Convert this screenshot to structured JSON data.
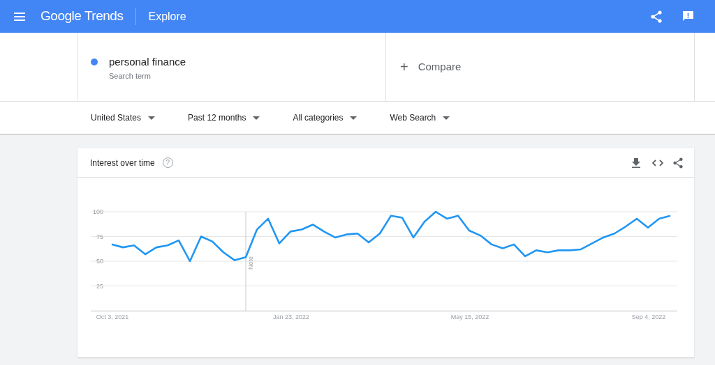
{
  "header": {
    "logo": "Google Trends",
    "title": "Explore"
  },
  "search_term": {
    "text": "personal finance",
    "subtitle": "Search term",
    "color": "#4285f4"
  },
  "compare": {
    "label": "Compare",
    "plus": "+"
  },
  "filters": [
    {
      "label": "United States"
    },
    {
      "label": "Past 12 months"
    },
    {
      "label": "All categories"
    },
    {
      "label": "Web Search"
    }
  ],
  "interest_card": {
    "title": "Interest over time",
    "help": "?",
    "chart_data": {
      "type": "line",
      "categories": [
        "Oct 3, 2021",
        null,
        null,
        null,
        null,
        null,
        null,
        null,
        null,
        null,
        null,
        null,
        null,
        null,
        null,
        null,
        "Jan 23, 2022",
        null,
        null,
        null,
        null,
        null,
        null,
        null,
        null,
        null,
        null,
        null,
        null,
        null,
        null,
        null,
        "May 15, 2022",
        null,
        null,
        null,
        null,
        null,
        null,
        null,
        null,
        null,
        null,
        null,
        null,
        null,
        null,
        null,
        "Sep 4, 2022",
        null,
        null
      ],
      "ylim": [
        0,
        100
      ],
      "yticks": [
        25,
        50,
        75,
        100
      ],
      "grid": true,
      "annotations": [
        "Note"
      ],
      "series": [
        {
          "color": "#2196f3",
          "values": [
            67,
            64,
            66,
            57,
            64,
            66,
            71,
            50,
            75,
            70,
            59,
            51,
            54,
            82,
            93,
            68,
            80,
            82,
            87,
            80,
            74,
            77,
            78,
            69,
            78,
            96,
            94,
            74,
            90,
            100,
            93,
            96,
            81,
            76,
            67,
            63,
            67,
            55,
            61,
            59,
            61,
            61,
            62,
            68,
            74,
            78,
            85,
            93,
            84,
            93,
            96
          ]
        }
      ]
    }
  }
}
